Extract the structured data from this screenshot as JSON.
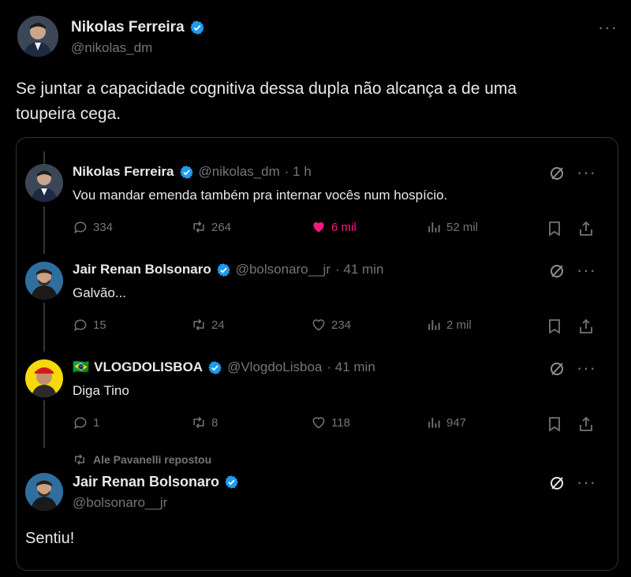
{
  "main_tweet": {
    "display_name": "Nikolas Ferreira",
    "handle": "@nikolas_dm",
    "text_line1": "Se juntar a capacidade cognitiva dessa dupla não alcança a de uma",
    "text_line2": "toupeira cega."
  },
  "quoted_thread": {
    "replies": [
      {
        "display_name": "Nikolas Ferreira",
        "handle": "@nikolas_dm",
        "time": "· 1 h",
        "text": "Vou mandar emenda também pra internar vocês num hospício.",
        "replies": "334",
        "retweets": "264",
        "likes": "6 mil",
        "views": "52 mil",
        "liked": true
      },
      {
        "display_name": "Jair Renan Bolsonaro",
        "handle": "@bolsonaro__jr",
        "time": "· 41 min",
        "text": "Galvão...",
        "replies": "15",
        "retweets": "24",
        "likes": "234",
        "views": "2 mil",
        "liked": false
      },
      {
        "flag": "🇧🇷",
        "display_name": "VLOGDOLISBOA",
        "handle": "@VlogdoLisboa",
        "time": "· 41 min",
        "text": "Diga Tino",
        "replies": "1",
        "retweets": "8",
        "likes": "118",
        "views": "947",
        "liked": false
      }
    ],
    "repost_label": "Ale Pavanelli repostou",
    "final": {
      "display_name": "Jair Renan Bolsonaro",
      "handle": "@bolsonaro__jr",
      "text": "Sentiu!"
    }
  },
  "colors": {
    "background": "#000000",
    "text": "#e7e9ea",
    "muted": "#71767b",
    "verified": "#1d9bf0",
    "like": "#f91880",
    "border": "#2f3336"
  },
  "icons": {
    "more": "more-icon",
    "grok": "grok-icon",
    "reply": "reply-icon",
    "retweet": "retweet-icon",
    "like": "heart-icon",
    "views": "views-icon",
    "bookmark": "bookmark-icon",
    "share": "share-icon"
  }
}
